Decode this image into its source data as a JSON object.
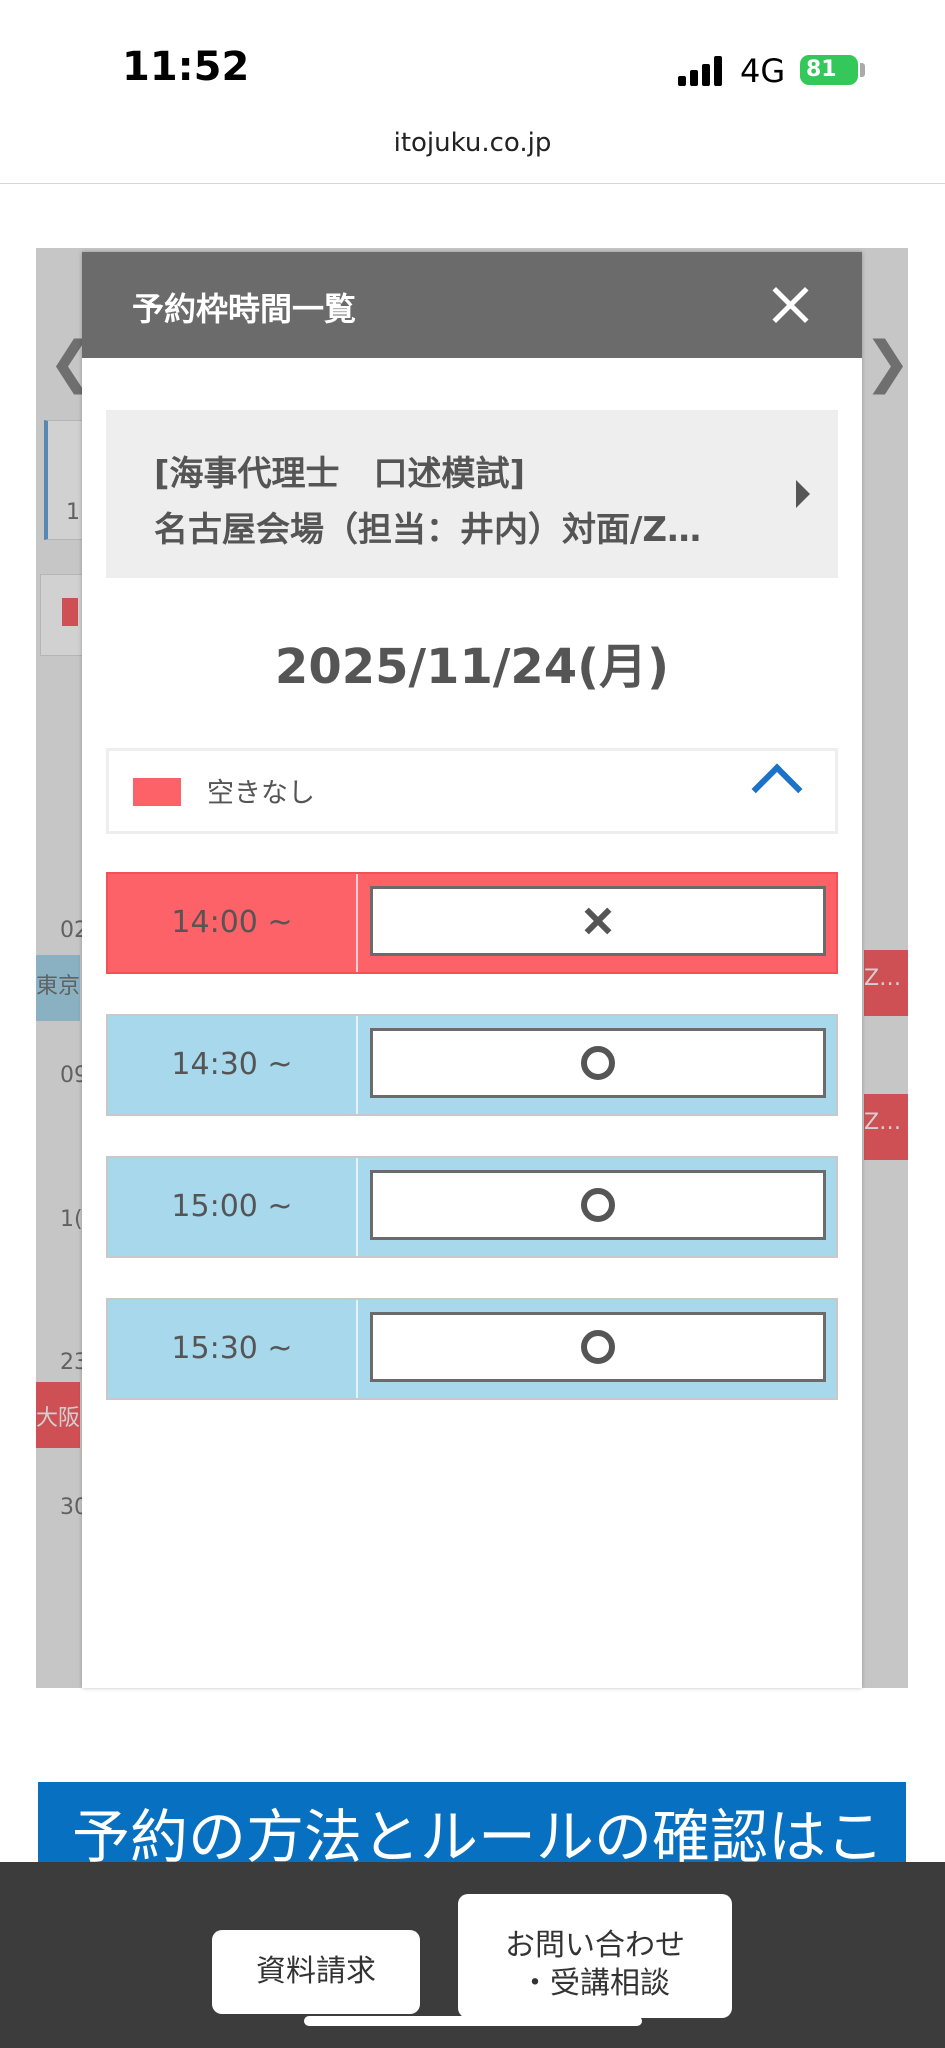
{
  "status_bar": {
    "time": "11:52",
    "network": "4G",
    "battery": "81"
  },
  "browser": {
    "url": "itojuku.co.jp"
  },
  "background_page": {
    "fragments": [
      "1",
      "02",
      "東京",
      "09",
      "1(",
      "23",
      "大阪",
      "30",
      "Z…",
      "Z…"
    ]
  },
  "modal": {
    "title": "予約枠時間一覧",
    "exam_line1": "[海事代理士　口述模試]",
    "exam_line2": "名古屋会場（担当：井内）対面/Z…",
    "date": "2025/11/24(月)",
    "legend": {
      "label": "空きなし",
      "color": "#fc6267"
    },
    "slots": [
      {
        "time": "14:00 ~",
        "status": "full",
        "mark": "×"
      },
      {
        "time": "14:30 ~",
        "status": "open",
        "mark": "○"
      },
      {
        "time": "15:00 ~",
        "status": "open",
        "mark": "○"
      },
      {
        "time": "15:30 ~",
        "status": "open",
        "mark": "○"
      }
    ]
  },
  "banner": {
    "text": "予約の方法とルールの確認はこ"
  },
  "footer": {
    "request_button": "資料請求",
    "contact_line1": "お問い合わせ",
    "contact_line2": "・受講相談"
  },
  "colors": {
    "full": "#fc6267",
    "open": "#a8d8ec",
    "banner": "#0870c0",
    "accent": "#1a73c8"
  }
}
